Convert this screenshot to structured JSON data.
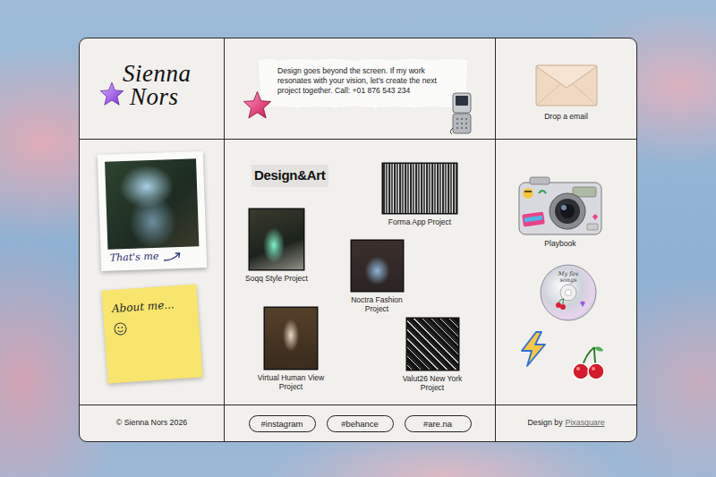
{
  "header": {
    "logo": [
      "Sienna",
      "Nors"
    ],
    "message": "Design goes beyond the screen. If my work resonates with your vision, let's create the next project together. Call: +01 876 543 234",
    "email_label": "Drop a email"
  },
  "profile": {
    "photo_caption": "That's me",
    "note": "About me..."
  },
  "gallery": {
    "title": "Design&Art",
    "projects": [
      {
        "title": "Forma App Project"
      },
      {
        "title": "Soqq Style Project"
      },
      {
        "title": "Noctra Fashion Project"
      },
      {
        "title": "Virtual Human View Project"
      },
      {
        "title": "Valut26 New York Project"
      }
    ]
  },
  "stickers": {
    "camera_label": "Playbook",
    "cd_label": "My fav songs"
  },
  "footer": {
    "copyright": "© Sienna Nors 2026",
    "links": [
      "#instagram",
      "#behance",
      "#are.na"
    ],
    "credit": "Design by",
    "credit_link": "Pixasquare"
  }
}
